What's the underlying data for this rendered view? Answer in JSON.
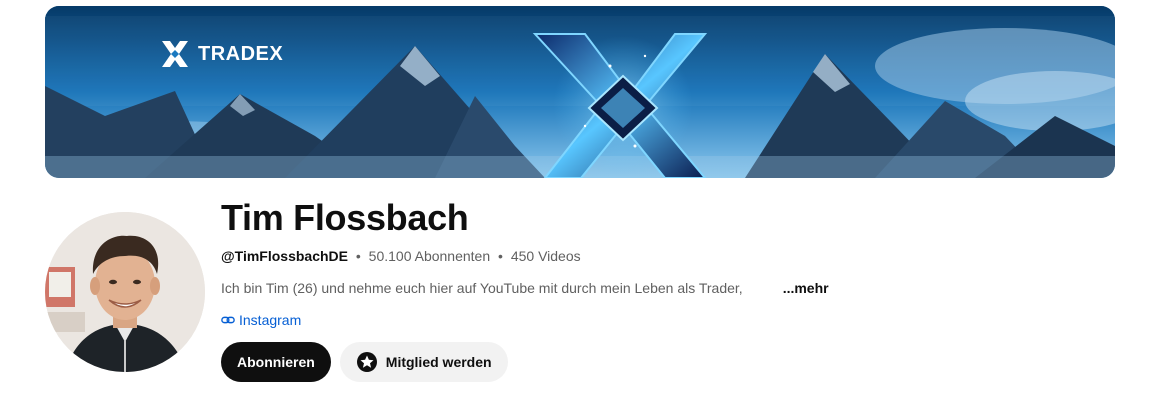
{
  "banner": {
    "brand_name": "TRADEX",
    "brand_logo_icon": "tradex-logo-icon",
    "center_art": "x-crystal-art",
    "colors": {
      "sky_top": "#0a4f86",
      "sky_bottom": "#7fc3ec",
      "mountain": "#1d2f45"
    }
  },
  "channel": {
    "name": "Tim Flossbach",
    "handle": "@TimFlossbachDE",
    "separator": "•",
    "subscribers": "50.100 Abonnenten",
    "videos": "450 Videos",
    "description": "Ich bin Tim (26) und nehme euch hier auf YouTube mit durch mein Leben als Trader,",
    "more_label": "...mehr",
    "link": {
      "icon": "link-icon",
      "label": "Instagram"
    }
  },
  "actions": {
    "subscribe_label": "Abonnieren",
    "member_label": "Mitglied werden",
    "member_icon": "star-badge-icon"
  },
  "colors": {
    "text_primary": "#0f0f0f",
    "text_secondary": "#606060",
    "link": "#065fd4",
    "subscribe_bg": "#0f0f0f",
    "member_bg": "#f2f2f2"
  }
}
